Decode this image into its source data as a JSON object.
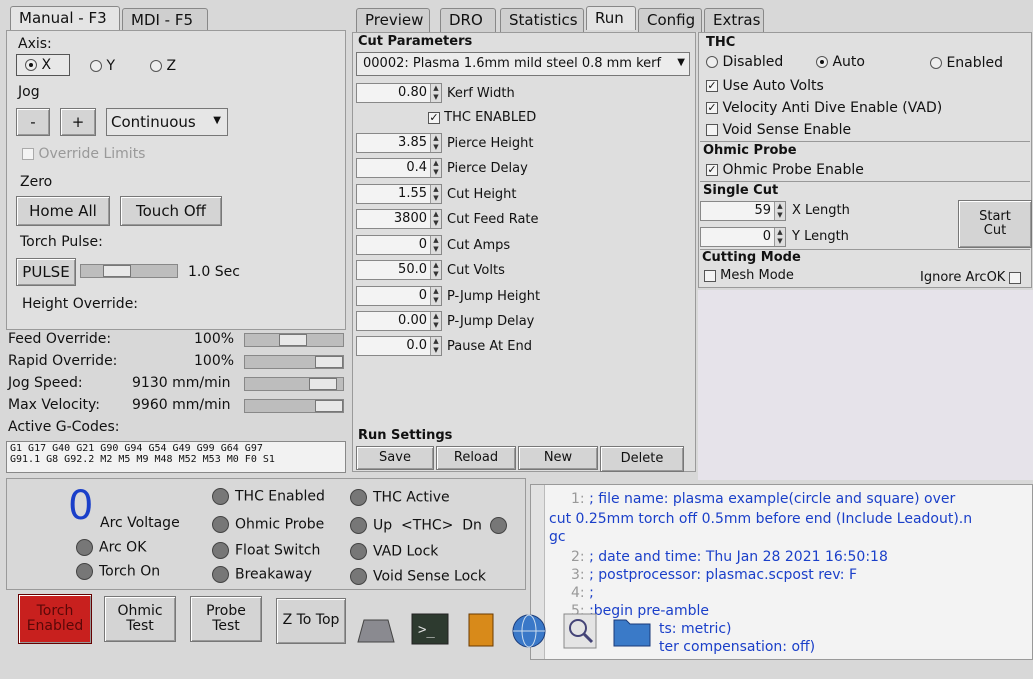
{
  "left_tabs": [
    "Manual - F3",
    "MDI - F5"
  ],
  "right_tabs": [
    "Preview",
    "DRO",
    "Statistics",
    "Run",
    "Config",
    "Extras"
  ],
  "manual": {
    "axis_label": "Axis:",
    "axes": [
      "X",
      "Y",
      "Z"
    ],
    "jog_label": "Jog",
    "jog_minus": "-",
    "jog_plus": "+",
    "jog_mode": "Continuous",
    "override_limits": "Override Limits",
    "zero_label": "Zero",
    "home_all": "Home All",
    "touch_off": "Touch Off",
    "torch_pulse_label": "Torch Pulse:",
    "pulse_button": "PULSE",
    "pulse_value": "1.0 Sec",
    "height_override_label": "Height Override:"
  },
  "overrides": [
    {
      "label": "Feed Override:",
      "value": "100%",
      "level": 0.6
    },
    {
      "label": "Rapid Override:",
      "value": "100%",
      "level": 0.9
    },
    {
      "label": "Jog Speed:",
      "value": "9130 mm/min",
      "level": 0.85
    },
    {
      "label": "Max Velocity:",
      "value": "9960 mm/min",
      "level": 0.95
    }
  ],
  "gcodes": {
    "label": "Active G-Codes:",
    "line1": "G1 G17 G40 G21 G90 G94 G54 G49 G99 G64 G97",
    "line2": "G91.1 G8 G92.2 M2 M5 M9 M48 M52 M53 M0 F0 S1"
  },
  "cut_parameters": {
    "title": "Cut Parameters",
    "material": "00002: Plasma 1.6mm mild steel 0.8 mm kerf",
    "kerf_value": "0.80",
    "kerf_label": "Kerf Width",
    "thc_enabled": "THC ENABLED",
    "params": [
      {
        "value": "3.85",
        "label": "Pierce Height"
      },
      {
        "value": "0.4",
        "label": "Pierce Delay"
      },
      {
        "value": "1.55",
        "label": "Cut Height"
      },
      {
        "value": "3800",
        "label": "Cut Feed Rate"
      },
      {
        "value": "0",
        "label": "Cut Amps"
      },
      {
        "value": "50.0",
        "label": "Cut Volts"
      },
      {
        "value": "0",
        "label": "P-Jump Height"
      },
      {
        "value": "0.00",
        "label": "P-Jump Delay"
      },
      {
        "value": "0.0",
        "label": "Pause At End"
      }
    ]
  },
  "run_settings": {
    "title": "Run Settings",
    "buttons": [
      "Save",
      "Reload",
      "New",
      "Delete"
    ]
  },
  "thc": {
    "title": "THC",
    "modes": [
      "Disabled",
      "Auto",
      "Enabled"
    ],
    "options": [
      "Use Auto Volts",
      "Velocity Anti Dive Enable (VAD)",
      "Void Sense Enable"
    ]
  },
  "ohmic": {
    "title": "Ohmic Probe",
    "option": "Ohmic Probe Enable"
  },
  "single_cut": {
    "title": "Single Cut",
    "x_value": "59",
    "x_label": "X Length",
    "y_value": "0",
    "y_label": "Y Length",
    "start_cut": "Start Cut"
  },
  "cutting_mode": {
    "title": "Cutting Mode",
    "mesh": "Mesh Mode",
    "ignore": "Ignore ArcOK"
  },
  "status": {
    "arc_voltage_value": "0",
    "arc_voltage_label": "Arc Voltage",
    "col1": [
      "Arc OK",
      "Torch On"
    ],
    "col2": [
      "THC Enabled",
      "Ohmic Probe",
      "Float Switch",
      "Breakaway"
    ],
    "col3": [
      "THC Active",
      "Up",
      "VAD Lock",
      "Void Sense Lock"
    ],
    "thc_arrow": "<THC>",
    "dn": "Dn"
  },
  "code_lines": [
    {
      "n": "1:",
      "text": "; file name: plasma example(circle and square) over"
    },
    {
      "n": "",
      "text": "cut 0.25mm torch off 0.5mm before end (Include Leadout).n"
    },
    {
      "n": "",
      "text": "gc"
    },
    {
      "n": "2:",
      "text": "; date and time: Thu Jan 28 2021   16:50:18"
    },
    {
      "n": "3:",
      "text": "; postprocessor: plasmac.scpost rev: F"
    },
    {
      "n": "4:",
      "text": ";"
    },
    {
      "n": "5:",
      "text": ";begin pre-amble"
    },
    {
      "n": "",
      "text": "ts: metric)"
    },
    {
      "n": "",
      "text": "ter compensation: off)"
    }
  ],
  "bottom_buttons": {
    "torch": "Torch Enabled",
    "ohmic": "Ohmic Test",
    "probe": "Probe Test",
    "ztop": "Z To Top"
  },
  "colors": {
    "torch_red": "#c8201e",
    "code_blue": "#1a3fc9"
  }
}
